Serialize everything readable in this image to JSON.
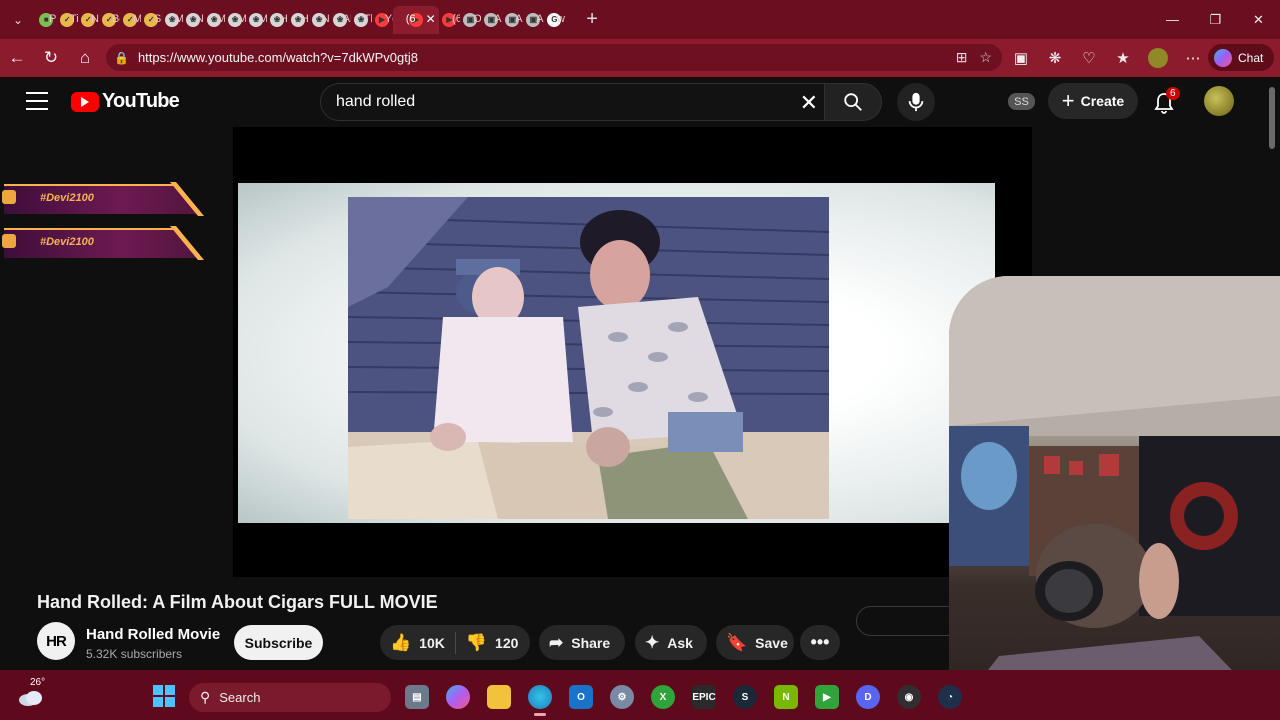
{
  "browser": {
    "tabs": [
      {
        "label": "Pi",
        "favicon": "doc-icon"
      },
      {
        "label": "Ti",
        "favicon": "check-icon"
      },
      {
        "label": "Ne",
        "favicon": "check-icon"
      },
      {
        "label": "Be",
        "favicon": "check-icon"
      },
      {
        "label": "M",
        "favicon": "check-icon"
      },
      {
        "label": "Su",
        "favicon": "check-icon"
      },
      {
        "label": "M",
        "favicon": "openai-icon"
      },
      {
        "label": "Ne",
        "favicon": "openai-icon"
      },
      {
        "label": "M",
        "favicon": "openai-icon"
      },
      {
        "label": "M",
        "favicon": "openai-icon"
      },
      {
        "label": "M",
        "favicon": "openai-icon"
      },
      {
        "label": "He",
        "favicon": "openai-icon"
      },
      {
        "label": "He",
        "favicon": "openai-icon"
      },
      {
        "label": "Ne",
        "favicon": "openai-icon"
      },
      {
        "label": "Al",
        "favicon": "openai-icon"
      },
      {
        "label": "Th",
        "favicon": "openai-icon"
      },
      {
        "label": "Yc",
        "favicon": "youtube-icon"
      },
      {
        "label": "(6",
        "favicon": "youtube-icon"
      },
      {
        "label": "(6",
        "favicon": "youtube-icon"
      },
      {
        "label": "Ol",
        "favicon": "generic-icon"
      },
      {
        "label": "Ai",
        "favicon": "generic-icon"
      },
      {
        "label": "Ai",
        "favicon": "generic-icon"
      },
      {
        "label": "Ai",
        "favicon": "generic-icon"
      },
      {
        "label": "wi",
        "favicon": "google-icon"
      }
    ],
    "active_tab_index": 17,
    "url": "https://www.youtube.com/watch?v=7dkWPv0gtj8",
    "chat_label": "Chat"
  },
  "youtube": {
    "logo_text": "YouTube",
    "search_value": "hand rolled",
    "ss_badge": "SS",
    "create_label": "Create",
    "notification_count": "6",
    "video_title": "Hand Rolled: A Film About Cigars FULL MOVIE",
    "channel_name": "Hand Rolled Movie",
    "channel_initials": "HR",
    "subscribers": "5.32K subscribers",
    "subscribe_label": "Subscribe",
    "likes": "10K",
    "dislikes": "120",
    "share_label": "Share",
    "ask_label": "Ask",
    "save_label": "Save",
    "more_label": "•••"
  },
  "overlay": {
    "hashtags": [
      "#Devi2100",
      "#Devi2100"
    ]
  },
  "taskbar": {
    "temperature": "26°",
    "search_placeholder": "Search",
    "apps": [
      "file-explorer",
      "copilot",
      "folder",
      "edge",
      "outlook",
      "settings",
      "xbox",
      "epic-games",
      "steam",
      "nvidia",
      "gamepass",
      "discord",
      "obs",
      "speedtest"
    ]
  },
  "colors": {
    "tabbar": "#6a0e20",
    "addressbar": "#8c1b2e",
    "youtube_red": "#ff0000",
    "hashtag_gold": "#f6b451"
  }
}
